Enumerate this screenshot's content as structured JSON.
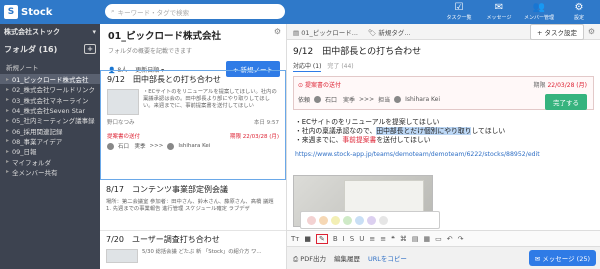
{
  "app": {
    "name": "Stock",
    "logo_letter": "S"
  },
  "search": {
    "placeholder": "キーワード・タグで検索"
  },
  "top_icons": [
    {
      "icon": "task-list-icon",
      "label": "タスク一覧"
    },
    {
      "icon": "message-icon",
      "label": "メッセージ"
    },
    {
      "icon": "members-icon",
      "label": "メンバー管理"
    },
    {
      "icon": "settings-icon",
      "label": "設定"
    }
  ],
  "sidebar": {
    "company": "株式会社ストック",
    "folder_label": "フォルダ (16)",
    "add": "+",
    "section": "新規ノート",
    "items": [
      "01_ピックロード株式会社",
      "02_株式会社ワールドリンク",
      "03_株式会社マネーライン",
      "04_株式会社Seven Star",
      "05_社内ミーティング議事録",
      "06_採用関連記録",
      "08_事業アイデア",
      "09_日報",
      "マイフォルダ",
      "全メンバー共有"
    ]
  },
  "middle": {
    "title": "01_ピックロード株式会社",
    "desc": "フォルダの概要を記載できます",
    "members": "8人",
    "sort": "更新日順",
    "new_note": "+ 新規ノート",
    "notes": [
      {
        "title": "9/12　田中部長との打ち合わせ",
        "text": "・ECサイトのをリニューアルを提案してほしい。社内の稟議承認は会の。田中部長より部にやり取りしてほしい。来週までに、事前提案書を送付してほしい",
        "author": "野口なつみ",
        "date": "本日 9:57",
        "task_label": "提案書の送付",
        "due": "期限 22/03/28 (月)",
        "assignee": "石口　実季",
        "arrow": ">>>",
        "assigner": "Ishihara Kei"
      },
      {
        "title": "8/17　コンテンツ事業部定例会議",
        "text": "場所：第二会議室 参加者：田中さん、鈴木さん、藤原さん、高橋 議題 1. 先週までの事業報告 進行管理 スケジュール確定 ラブデザ"
      },
      {
        "title": "7/20　ユーザー調査打ち合わせ",
        "text": "5/30 総括会議 どたぶ 新 「Stock」の紹介方 ワ..."
      }
    ]
  },
  "detail": {
    "tab_title": "01_ピックロード...",
    "tab_new": "新規タグ...",
    "add_task": "+ タスク設定",
    "title": "9/12　田中部長との打ち合わせ",
    "sub_on": "対応中 (1)",
    "sub_done": "完了 (44)",
    "task_label": "提案書の送付",
    "due_prefix": "期限",
    "due_date": "22/03/28 (月)",
    "requester": "依頼",
    "assignee": "石口　実季",
    "arrow": ">>>",
    "assigner_label": "担当",
    "assigner": "Ishihara Kei",
    "done_btn": "完了する",
    "line1": "・ECサイトのをリニューアルを提案してほしい",
    "line2_a": "・社内の稟議承認なので、",
    "line2_hl": "田中部長とだけ個別にやり取り",
    "line2_b": "してほしい",
    "line3_a": "・来週までに、",
    "line3_link": "事前提案書",
    "line3_b": "を送付してほしい",
    "url": "https://www.stock-app.jp/teams/demoteam/demoteam/6222/stocks/88952/edit"
  },
  "toolbar": {
    "items": [
      "Tт",
      "■",
      "✎",
      "B",
      "I",
      "S",
      "U",
      "≡",
      "≡",
      "❝",
      "⌘",
      "▤",
      "▦",
      "▭",
      "↶",
      "↷"
    ]
  },
  "actions": {
    "pdf": "PDF出力",
    "history": "編集履歴",
    "copy_url": "URLをコピー",
    "message": "メッセージ (25)"
  },
  "colors": [
    "#f3d2d2",
    "#f6d8b5",
    "#f3efb5",
    "#cfeac7",
    "#c9dff5",
    "#dcd0f0",
    "#e6e6e6"
  ]
}
